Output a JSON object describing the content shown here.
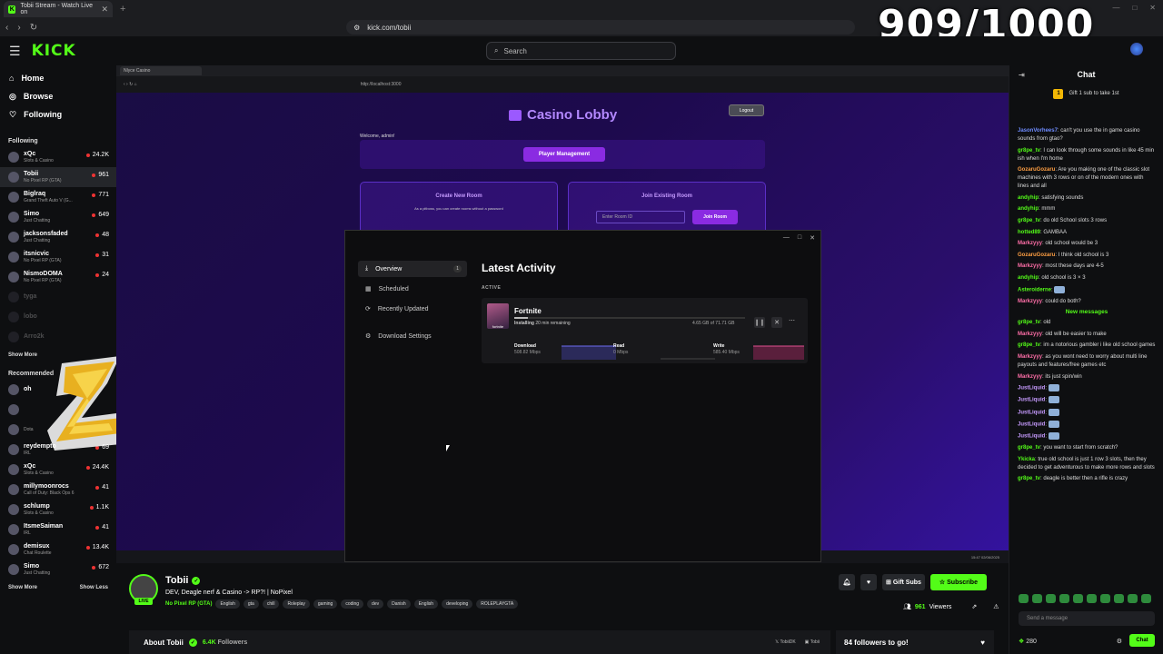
{
  "browser": {
    "tab_title": "Tobii Stream - Watch Live on",
    "url": "kick.com/tobii"
  },
  "overlay_counter": "909/1000",
  "site": {
    "logo": "KICK",
    "search_placeholder": "Search"
  },
  "sidebar": {
    "nav": [
      {
        "label": "Home",
        "icon": "home-icon"
      },
      {
        "label": "Browse",
        "icon": "compass-icon"
      },
      {
        "label": "Following",
        "icon": "heart-icon"
      }
    ],
    "following_header": "Following",
    "following": [
      {
        "name": "xQc",
        "category": "Slots & Casino",
        "viewers": "24.2K"
      },
      {
        "name": "Tobii",
        "category": "No Pixel RP (GTA)",
        "viewers": "961"
      },
      {
        "name": "Biglraq",
        "category": "Grand Theft Auto V (G...",
        "viewers": "771"
      },
      {
        "name": "Simo",
        "category": "Just Chatting",
        "viewers": "649"
      },
      {
        "name": "jacksonsfaded",
        "category": "Just Chatting",
        "viewers": "48"
      },
      {
        "name": "itsnicvic",
        "category": "No Pixel RP (GTA)",
        "viewers": "31"
      },
      {
        "name": "NismoDOMA",
        "category": "No Pixel RP (GTA)",
        "viewers": "24"
      },
      {
        "name": "tyga",
        "category": "",
        "viewers": ""
      },
      {
        "name": "lobo",
        "category": "",
        "viewers": ""
      },
      {
        "name": "Arro2k",
        "category": "",
        "viewers": ""
      }
    ],
    "show_more": "Show More",
    "recommended_header": "Recommended",
    "recommended": [
      {
        "name": "oh",
        "category": "",
        "viewers": ""
      },
      {
        "name": "",
        "category": "",
        "viewers": ""
      },
      {
        "name": "",
        "category": "Dota",
        "viewers": ""
      },
      {
        "name": "reydempto",
        "category": "IRL",
        "viewers": "69"
      },
      {
        "name": "xQc",
        "category": "Slots & Casino",
        "viewers": "24.4K"
      },
      {
        "name": "millymoonrocs",
        "category": "Call of Duty: Black Ops 6",
        "viewers": "41"
      },
      {
        "name": "schlump",
        "category": "Slots & Casino",
        "viewers": "1.1K"
      },
      {
        "name": "ItsmeSaiman",
        "category": "IRL",
        "viewers": "41"
      },
      {
        "name": "demisux",
        "category": "Chat Roulette",
        "viewers": "13.4K"
      },
      {
        "name": "Simo",
        "category": "Just Chatting",
        "viewers": "672"
      }
    ],
    "show_more_2": "Show More",
    "show_less": "Show Less"
  },
  "stream_view": {
    "inner_tab": "Nlyce Casino",
    "inner_url": "http://localhost:3000",
    "lobby_title": "Casino Lobby",
    "logout": "Logout",
    "welcome": "Welcome, admin!",
    "player_mgmt": "Player Management",
    "create_room_title": "Create New Room",
    "create_room_sub": "As a pitboss, you can create rooms without a password",
    "join_room_title": "Join Existing Room",
    "room_placeholder": "Enter Room ID",
    "join_btn": "Join Room",
    "clock": "15:47\n02/06/2025"
  },
  "download_window": {
    "nav": [
      {
        "label": "Overview",
        "icon": "download-icon",
        "badge": "1"
      },
      {
        "label": "Scheduled",
        "icon": "calendar-icon",
        "badge": ""
      },
      {
        "label": "Recently Updated",
        "icon": "refresh-icon",
        "badge": ""
      },
      {
        "label": "Download Settings",
        "icon": "gear-icon",
        "badge": ""
      }
    ],
    "heading": "Latest Activity",
    "active_label": "ACTIVE",
    "game": "Fortnite",
    "status": "Installing",
    "remaining": "20 min remaining",
    "progress": 0.06,
    "size": "4.65 GB of 71.71 GB",
    "stats": [
      {
        "label": "Download",
        "value": "508.82 Mbps"
      },
      {
        "label": "Read",
        "value": "0 Mbps"
      },
      {
        "label": "Write",
        "value": "585.40 Mbps"
      }
    ]
  },
  "chat": {
    "title": "Chat",
    "gift_text": "Gift 1 sub to take 1st",
    "gift_badge": "1",
    "messages": [
      {
        "user": "JasonVorhees7",
        "color": "#6f8cff",
        "text": "can't you use the in game casino sounds from gtao?"
      },
      {
        "user": "gr8pe_tv",
        "color": "#53fc18",
        "text": "I can look through some sounds in like 45 min ish when I'm home"
      },
      {
        "user": "GozaruGozaru",
        "color": "#ff9f43",
        "text": "Are you making one of the classic slot machines with 3 rows or on of the modern ones with lines and all"
      },
      {
        "user": "andyhip",
        "color": "#53fc18",
        "text": "satisfying sounds"
      },
      {
        "user": "andyhip",
        "color": "#53fc18",
        "text": "mmm"
      },
      {
        "user": "gr8pe_tv",
        "color": "#53fc18",
        "text": "do old School slots 3 rows"
      },
      {
        "user": "hotted89",
        "color": "#53fc18",
        "text": "GAMBAA"
      },
      {
        "user": "Markzyyy",
        "color": "#ff6fa8",
        "text": "old school would be 3"
      },
      {
        "user": "GozaruGozaru",
        "color": "#ff9f43",
        "text": "I think old school is 3"
      },
      {
        "user": "Markzyyy",
        "color": "#ff6fa8",
        "text": "most these days are 4-5"
      },
      {
        "user": "andyhip",
        "color": "#53fc18",
        "text": "old school is 3 × 3"
      },
      {
        "user": "Asteroiderne",
        "color": "#53fc18",
        "text": ""
      },
      {
        "user": "Markzyyy",
        "color": "#ff6fa8",
        "text": "could do both?"
      }
    ],
    "new_messages": "New messages",
    "messages2": [
      {
        "user": "gr8pe_tv",
        "color": "#53fc18",
        "text": "old"
      },
      {
        "user": "Markzyyy",
        "color": "#ff6fa8",
        "text": "old will be easier to make"
      },
      {
        "user": "gr8pe_tv",
        "color": "#53fc18",
        "text": "im a notorious gambler i like old school games"
      },
      {
        "user": "Markzyyy",
        "color": "#ff6fa8",
        "text": "as you wont need to worry about multi line payouts and features/free games etc"
      },
      {
        "user": "Markzyyy",
        "color": "#ff6fa8",
        "text": "its just spin/win"
      },
      {
        "user": "JustLiquid",
        "color": "#c79bff",
        "text": ""
      },
      {
        "user": "JustLiquid",
        "color": "#c79bff",
        "text": ""
      },
      {
        "user": "JustLiquid",
        "color": "#c79bff",
        "text": ""
      },
      {
        "user": "JustLiquid",
        "color": "#c79bff",
        "text": ""
      },
      {
        "user": "JustLiquid",
        "color": "#c79bff",
        "text": ""
      },
      {
        "user": "gr8pe_tv",
        "color": "#53fc18",
        "text": "you want to start from scratch?"
      },
      {
        "user": "Ykicka",
        "color": "#53fc18",
        "text": "true old school is just 1 row 3 slots, then they decided to get adventurous to make more rows and slots"
      },
      {
        "user": "gr8pe_tv",
        "color": "#53fc18",
        "text": "deagle is better then a rifle is crazy"
      }
    ],
    "input_placeholder": "Send a message",
    "points": "280",
    "chat_btn": "Chat"
  },
  "channel": {
    "name": "Tobii",
    "live": "LIVE",
    "title": "DEV, Deagle nerf & Casino -> RP?! | NoPixel",
    "category": "No Pixel RP (GTA)",
    "tags": [
      "English",
      "gta",
      "chill",
      "Roleplay",
      "gaming",
      "coding",
      "dev",
      "Danish",
      "English",
      "developing",
      "ROLEPLAYGTA"
    ],
    "gift_subs": "Gift Subs",
    "subscribe": "Subscribe",
    "viewers": "961",
    "viewers_label": "Viewers",
    "about": "About Tobii",
    "followers": "6.4K",
    "followers_label": "Followers",
    "socials": [
      "TobiiDK",
      "Tobii"
    ],
    "goal": "84 followers to go!"
  }
}
